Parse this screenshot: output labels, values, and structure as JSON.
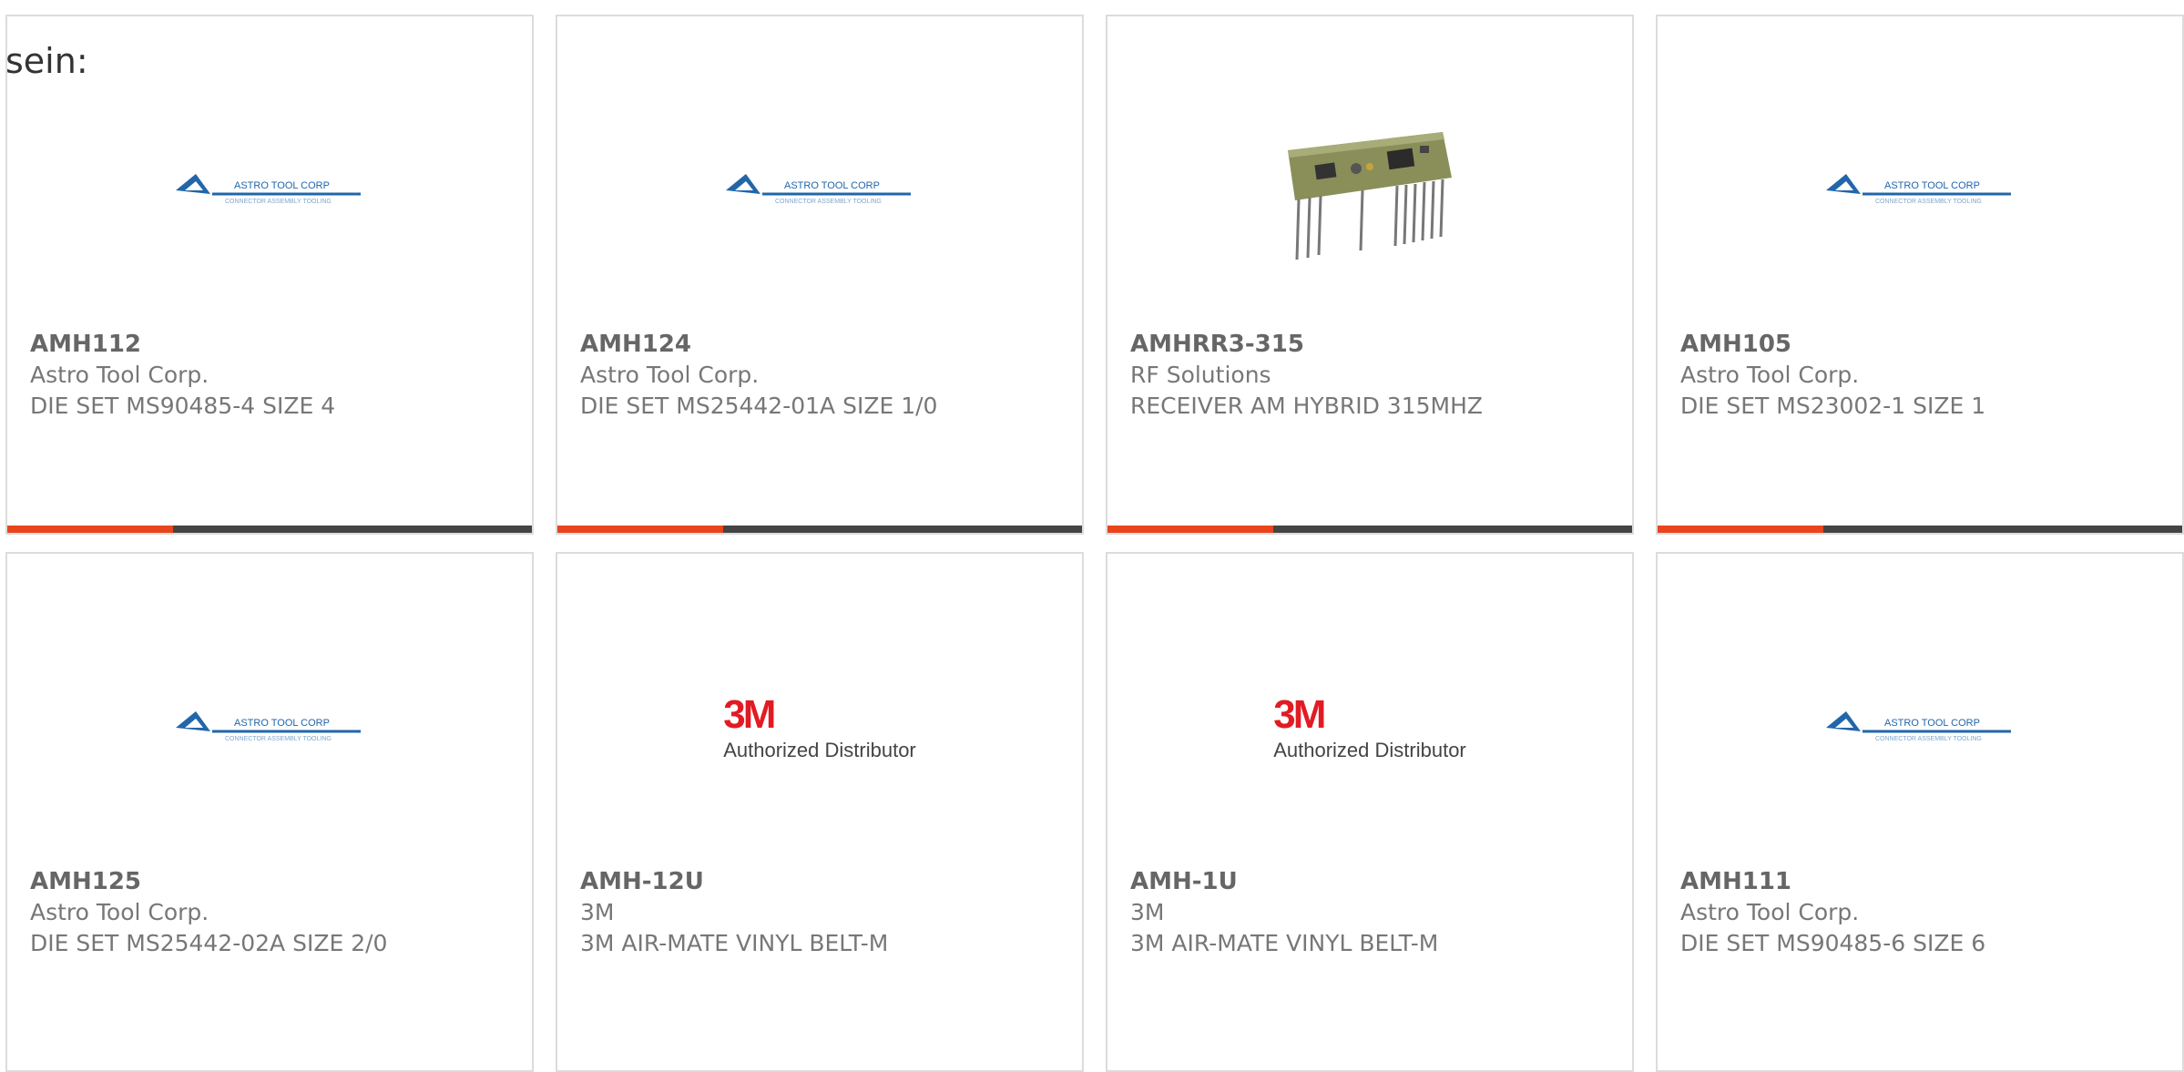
{
  "intro_text": "sein:",
  "colors": {
    "accent": "#e8451c",
    "bar": "#444444",
    "border": "#dcdcdc"
  },
  "products": [
    {
      "part": "AMH112",
      "manufacturer": "Astro Tool Corp.",
      "description": "DIE SET MS90485-4 SIZE 4",
      "logo": "astro-tool-corp-logo",
      "logo_text": "ASTRO TOOL CORP",
      "logo_subtext": "CONNECTOR ASSEMBLY TOOLING"
    },
    {
      "part": "AMH124",
      "manufacturer": "Astro Tool Corp.",
      "description": "DIE SET MS25442-01A SIZE 1/0",
      "logo": "astro-tool-corp-logo",
      "logo_text": "ASTRO TOOL CORP",
      "logo_subtext": "CONNECTOR ASSEMBLY TOOLING"
    },
    {
      "part": "AMHRR3-315",
      "manufacturer": "RF Solutions",
      "description": "RECEIVER AM HYBRID 315MHZ",
      "logo": "receiver-module-image"
    },
    {
      "part": "AMH105",
      "manufacturer": "Astro Tool Corp.",
      "description": "DIE SET MS23002-1 SIZE 1",
      "logo": "astro-tool-corp-logo",
      "logo_text": "ASTRO TOOL CORP",
      "logo_subtext": "CONNECTOR ASSEMBLY TOOLING"
    },
    {
      "part": "AMH125",
      "manufacturer": "Astro Tool Corp.",
      "description": "DIE SET MS25442-02A SIZE 2/0",
      "logo": "astro-tool-corp-logo",
      "logo_text": "ASTRO TOOL CORP",
      "logo_subtext": "CONNECTOR ASSEMBLY TOOLING"
    },
    {
      "part": "AMH-12U",
      "manufacturer": "3M",
      "description": "3M AIR-MATE VINYL BELT-M",
      "logo": "3m-authorized-distributor-logo",
      "logo_text": "3M",
      "logo_subtext": "Authorized Distributor"
    },
    {
      "part": "AMH-1U",
      "manufacturer": "3M",
      "description": "3M AIR-MATE VINYL BELT-M",
      "logo": "3m-authorized-distributor-logo",
      "logo_text": "3M",
      "logo_subtext": "Authorized Distributor"
    },
    {
      "part": "AMH111",
      "manufacturer": "Astro Tool Corp.",
      "description": "DIE SET MS90485-6 SIZE 6",
      "logo": "astro-tool-corp-logo",
      "logo_text": "ASTRO TOOL CORP",
      "logo_subtext": "CONNECTOR ASSEMBLY TOOLING"
    }
  ]
}
